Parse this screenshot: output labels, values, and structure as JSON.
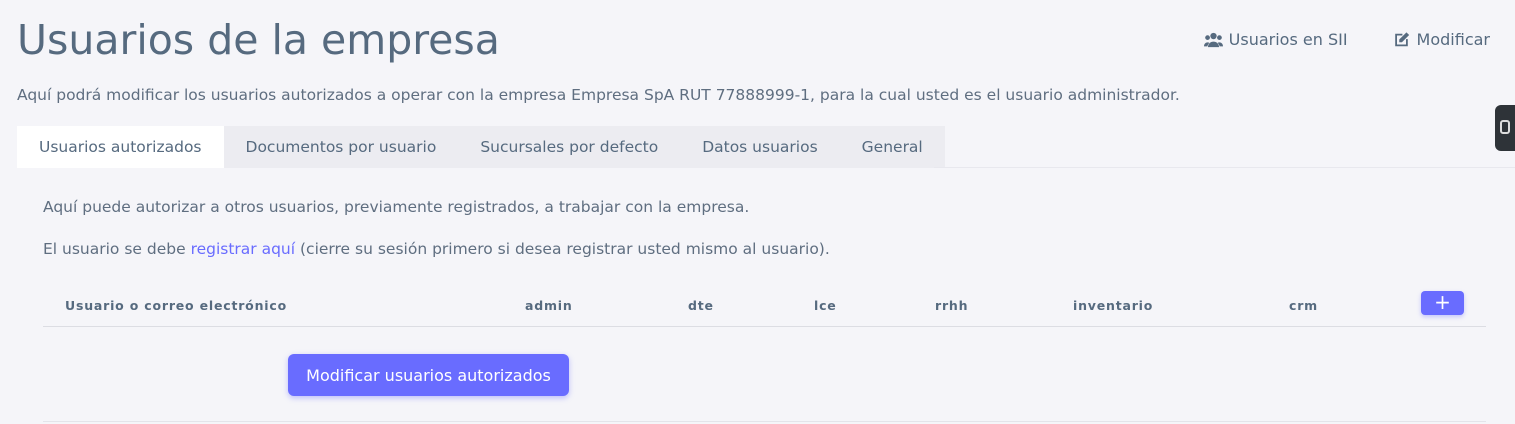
{
  "page": {
    "title": "Usuarios de la empresa",
    "intro": "Aquí podrá modificar los usuarios autorizados a operar con la empresa Empresa SpA RUT 77888999-1, para la cual usted es el usuario administrador."
  },
  "actions": {
    "sii_users": {
      "label": "Usuarios en SII",
      "icon": "users-icon"
    },
    "edit": {
      "label": "Modificar",
      "icon": "edit-icon"
    }
  },
  "tabs": [
    {
      "label": "Usuarios autorizados",
      "active": true
    },
    {
      "label": "Documentos por usuario",
      "active": false
    },
    {
      "label": "Sucursales por defecto",
      "active": false
    },
    {
      "label": "Datos usuarios",
      "active": false
    },
    {
      "label": "General",
      "active": false
    }
  ],
  "panel": {
    "text1": "Aquí puede autorizar a otros usuarios, previamente registrados, a trabajar con la empresa.",
    "text2_before": "El usuario se debe ",
    "text2_link": "registrar aquí",
    "text2_after": " (cierre su sesión primero si desea registrar usted mismo al usuario)."
  },
  "table": {
    "columns": [
      "Usuario o correo electrónico",
      "admin",
      "dte",
      "lce",
      "rrhh",
      "inventario",
      "crm"
    ],
    "add_label": "+"
  },
  "submit_label": "Modificar usuarios autorizados",
  "colors": {
    "accent": "#696cff",
    "text": "#566a7f",
    "background": "#f5f5f9"
  }
}
